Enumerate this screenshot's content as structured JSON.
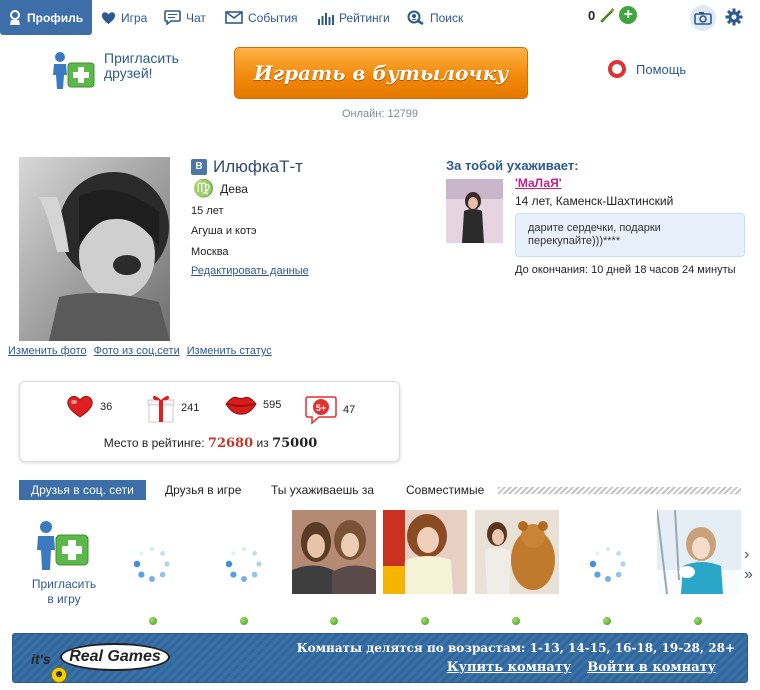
{
  "nav": {
    "profile": "Профиль",
    "game": "Игра",
    "chat": "Чат",
    "events": "События",
    "ratings": "Рейтинги",
    "search": "Поиск",
    "coins": "0"
  },
  "header": {
    "invite_friends": "Пригласить друзей!",
    "play_button": "Играть в бутылочку",
    "online": "Онлайн: 12799",
    "help": "Помощь"
  },
  "profile": {
    "name": "ИлюфкаТ-т",
    "zodiac_symbol": "♍",
    "zodiac": "Дева",
    "age": "15 лет",
    "status": "Агуша и котэ",
    "city": "Москва",
    "edit": "Редактировать данные",
    "change_photo": "Изменить фото",
    "social_photo": "Фото из соц.сети",
    "change_status": "Изменить статус"
  },
  "courting": {
    "title": "За тобой ухаживает:",
    "name": "'МаЛаЯ'",
    "info": "14 лет, Каменск-Шахтинский",
    "message": "дарите сердечки, подарки перекупайте)))****",
    "until": "До окончания: 10 дней 18 часов 24 минуты"
  },
  "stats": {
    "hearts": "36",
    "gifts": "241",
    "kisses": "595",
    "plus5": "47",
    "rating_label": "Место в рейтинге:",
    "rating_place": "72680",
    "rating_of": "из",
    "rating_total": "75000"
  },
  "tabs": {
    "social_friends": "Друзья в соц. сети",
    "game_friends": "Друзья в игре",
    "you_court": "Ты ухаживаешь за",
    "compatible": "Совместимые"
  },
  "friends": {
    "invite_to_game": "Пригласить в игру"
  },
  "banner": {
    "its": "it's",
    "brand": "Real Games",
    "rooms": "Комнаты делятся по возрастам: 1-13, 14-15, 16-18, 19-28, 28+",
    "buy_room": "Купить комнату",
    "enter_room": "Войти в комнату"
  },
  "colors": {
    "accent": "#3d6ea8",
    "link": "#2d5a8e",
    "play_button": "#f28a0c",
    "rating_place": "#c0392b",
    "online_dot": "#3a9a1a"
  }
}
